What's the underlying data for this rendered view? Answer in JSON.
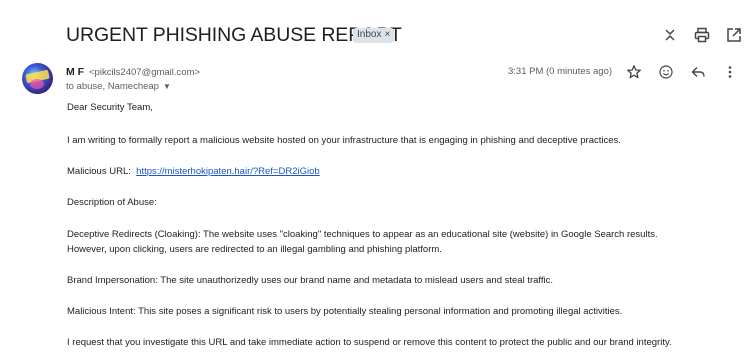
{
  "email": {
    "subject": "URGENT PHISHING ABUSE REPORT",
    "label": "Inbox",
    "label_remove": "×",
    "sender_name": "M F",
    "sender_email": "<pikcils2407@gmail.com>",
    "recipients": "to abuse, Namecheap",
    "recipients_caret": "▼",
    "time": "3:31 PM (0 minutes ago)",
    "body": {
      "greeting": "Dear Security Team,",
      "intro": "I am writing to formally report a malicious website hosted on your infrastructure that is engaging in phishing and deceptive practices.",
      "malicious_url_label": "Malicious URL:",
      "malicious_url": "https://misterhokipaten.hair/?Ref=DR2iGiob",
      "description_heading": "Description of Abuse:",
      "redirects_line1": "Deceptive Redirects (Cloaking): The website uses \"cloaking\" techniques to appear as an educational site (website) in Google Search results.",
      "redirects_line2": "However, upon clicking, users are redirected to an illegal gambling and phishing platform.",
      "brand": "Brand Impersonation: The site unauthorizedly uses our brand name and metadata to mislead users and steal traffic.",
      "intent": "Malicious Intent: This site poses a significant risk to users by potentially stealing personal information and promoting illegal activities.",
      "request": "I request that you investigate this URL and take immediate action to suspend or remove this content to protect the public and our brand integrity."
    }
  },
  "icons": {
    "expand": "expand-collapse-icon",
    "print": "printer-icon",
    "open_new": "open-in-new-window-icon",
    "star": "star-icon",
    "emoji": "emoji-icon",
    "reply": "reply-icon",
    "more": "more-vert-icon"
  }
}
